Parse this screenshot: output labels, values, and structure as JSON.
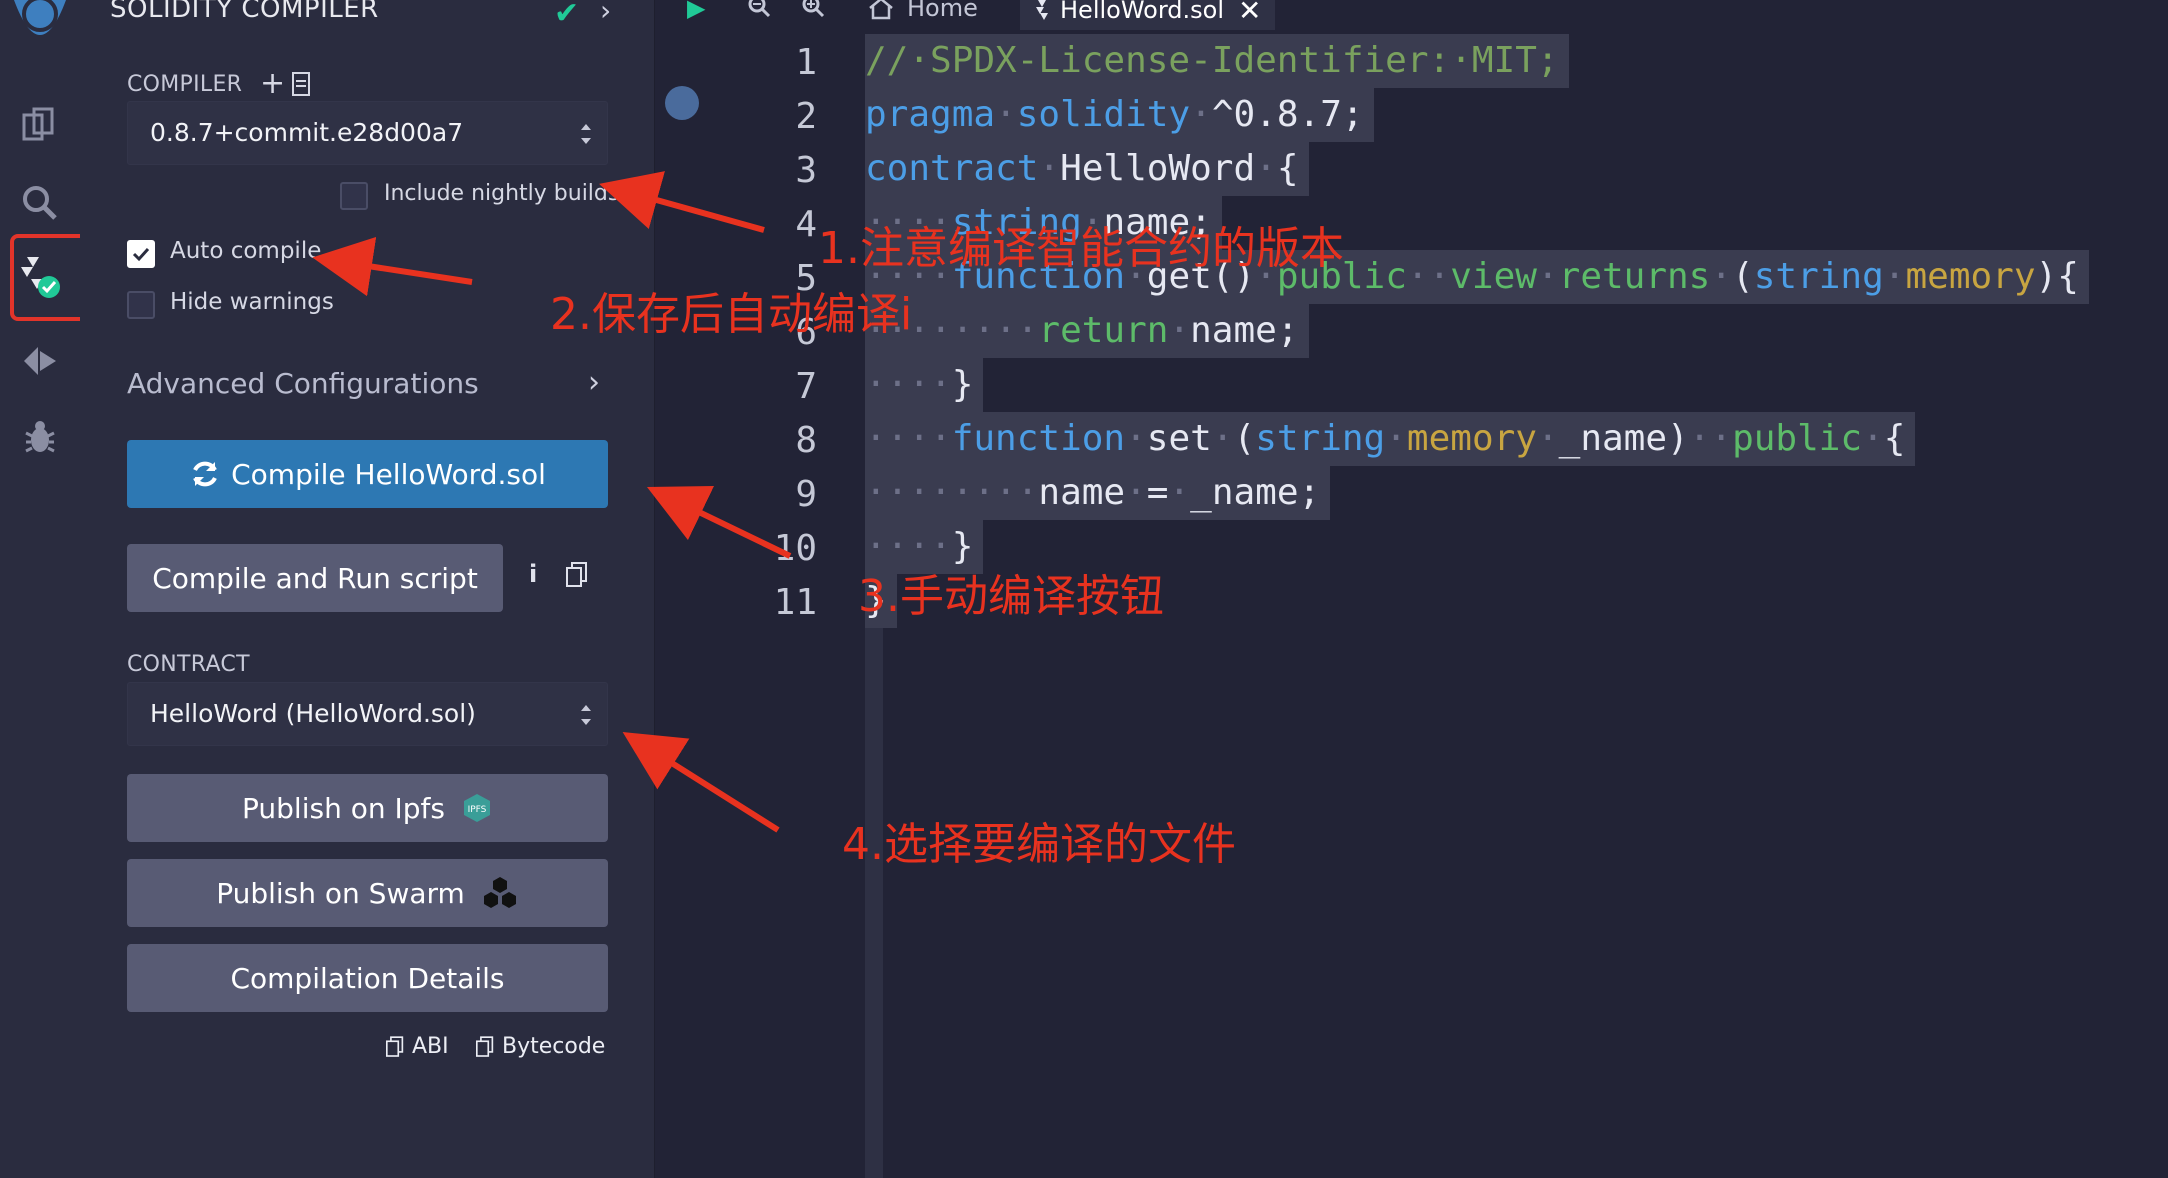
{
  "sidebar": {
    "icons": [
      "remix-logo-icon",
      "file-explorer-icon",
      "search-icon",
      "solidity-compiler-icon",
      "deploy-run-icon",
      "debugger-icon"
    ]
  },
  "panel": {
    "title": "SOLIDITY COMPILER",
    "compiler_label": "COMPILER",
    "compiler_version": "0.8.7+commit.e28d00a7",
    "include_nightly_label": "Include nightly builds",
    "include_nightly_checked": false,
    "auto_compile_label": "Auto compile",
    "auto_compile_checked": true,
    "hide_warnings_label": "Hide warnings",
    "hide_warnings_checked": false,
    "advanced_label": "Advanced Configurations",
    "compile_button": "Compile HelloWord.sol",
    "compile_run_button": "Compile and Run script",
    "contract_label": "CONTRACT",
    "contract_value": "HelloWord (HelloWord.sol)",
    "publish_ipfs": "Publish on Ipfs",
    "ipfs_badge": "IPFS",
    "publish_swarm": "Publish on Swarm",
    "compilation_details": "Compilation Details",
    "abi_link": "ABI",
    "bytecode_link": "Bytecode"
  },
  "editor": {
    "home_tab": "Home",
    "file_tab": "HelloWord.sol",
    "line_numbers": [
      "1",
      "2",
      "3",
      "4",
      "5",
      "6",
      "7",
      "8",
      "9",
      "10",
      "11"
    ]
  },
  "annotations": {
    "a1": "1.注意编译智能合约的版本",
    "a2": "2.保存后自动编译i",
    "a3": "3.手动编译按钮",
    "a4": "4.选择要编译的文件"
  },
  "colors": {
    "panel_bg": "#2a2c3f",
    "editor_bg": "#222336",
    "primary_button": "#2d78b3",
    "secondary_button": "#585b74",
    "annotation_red": "#e8321f",
    "check_green": "#20c997"
  }
}
